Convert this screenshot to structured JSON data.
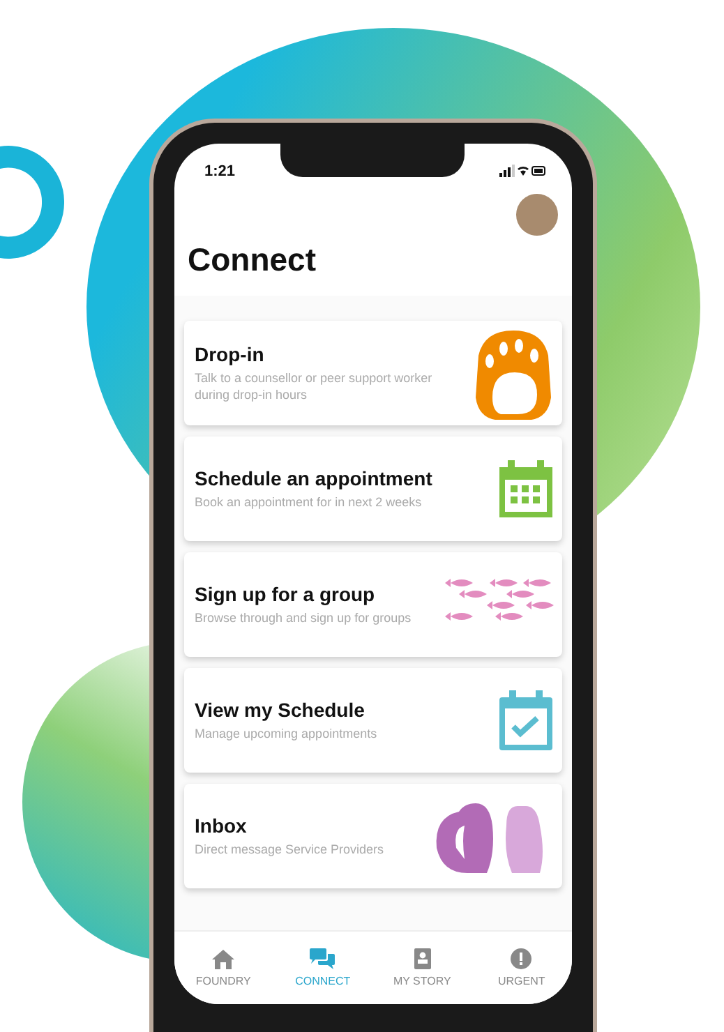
{
  "status_bar": {
    "time": "1:21"
  },
  "header": {
    "title": "Connect"
  },
  "cards": [
    {
      "kind": "paw",
      "title": "Drop-in",
      "subtitle": "Talk to a counsellor or peer support worker during drop-in hours"
    },
    {
      "kind": "calendar",
      "title": "Schedule an appointment",
      "subtitle": "Book an appointment for in next 2 weeks"
    },
    {
      "kind": "fish",
      "title": "Sign up for a group",
      "subtitle": "Browse through and sign up for groups"
    },
    {
      "kind": "calendar-check",
      "title": "View my Schedule",
      "subtitle": "Manage upcoming appointments"
    },
    {
      "kind": "otters",
      "title": "Inbox",
      "subtitle": "Direct message Service Providers"
    }
  ],
  "nav": [
    {
      "kind": "home",
      "label": "FOUNDRY",
      "selected": false
    },
    {
      "kind": "chat",
      "label": "CONNECT",
      "selected": true
    },
    {
      "kind": "book",
      "label": "MY STORY",
      "selected": false
    },
    {
      "kind": "alert",
      "label": "URGENT",
      "selected": false
    }
  ]
}
